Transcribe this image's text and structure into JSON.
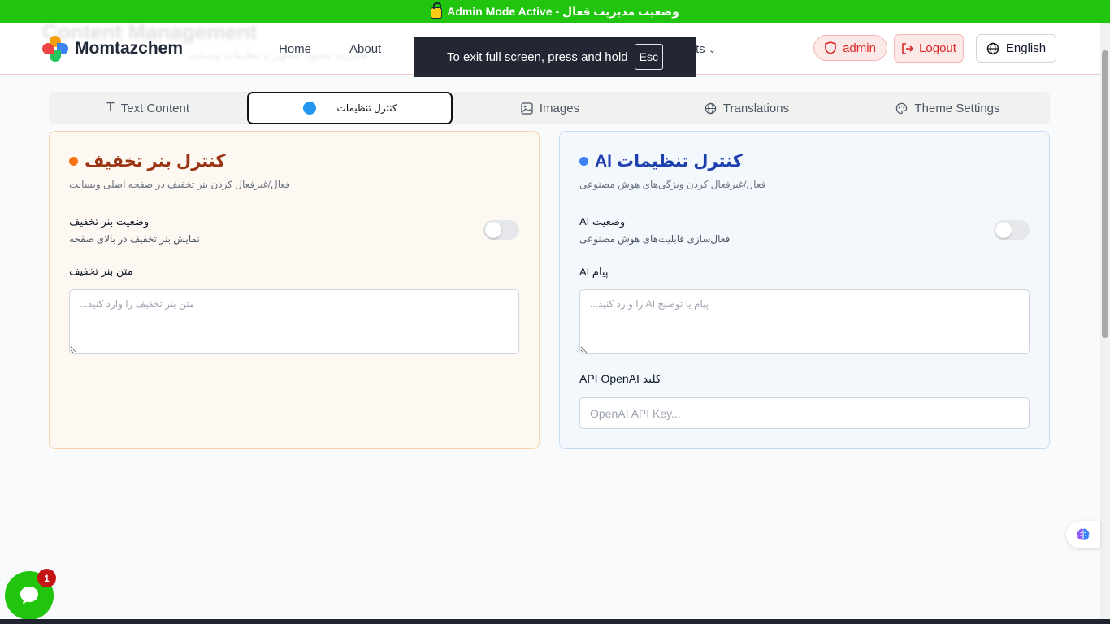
{
  "admin_bar": {
    "text": "وضعیت مدیریت فعال - Admin Mode Active"
  },
  "header": {
    "ghost_title": "Content Management",
    "ghost_subtitle": "مدیریت محتوا، تصاویر و تنظیمات وبسایت",
    "brand": "Momtazchem",
    "nav": [
      {
        "label": "Home"
      },
      {
        "label": "About"
      }
    ],
    "nav_partial": "ts",
    "admin_label": "admin",
    "logout_label": "Logout",
    "language_label": "English"
  },
  "fullscreen_toast": {
    "text": "To exit full screen, press and hold",
    "key": "Esc"
  },
  "tabs": [
    {
      "label": "Text Content",
      "icon": "text-icon"
    },
    {
      "label": "کنترل تنظیمات",
      "icon": "blue-dot-icon",
      "active": true
    },
    {
      "label": "Images",
      "icon": "image-icon"
    },
    {
      "label": "Translations",
      "icon": "globe-icon"
    },
    {
      "label": "Theme Settings",
      "icon": "palette-icon"
    }
  ],
  "discount_card": {
    "title": "کنترل بنر تخفیف",
    "description": "فعال/غیرفعال کردن بنر تخفیف در صفحه اصلی وبسایت",
    "toggle_label": "وضعیت بنر تخفیف",
    "toggle_sub": "نمایش بنر تخفیف در بالای صفحه",
    "toggle_on": false,
    "text_label": "متن بنر تخفیف",
    "text_placeholder": "متن بنر تخفیف را وارد کنید...",
    "accent": "#f97316"
  },
  "ai_card": {
    "title": "کنترل تنظیمات AI",
    "description": "فعال/غیرفعال کردن ویژگی‌های هوش مصنوعی",
    "toggle_label": "وضعیت AI",
    "toggle_sub": "فعال‌سازی قابلیت‌های هوش مصنوعی",
    "toggle_on": false,
    "message_label": "پیام AI",
    "message_placeholder": "پیام یا توضیح AI را وارد کنید...",
    "key_label": "کلید API OpenAI",
    "key_placeholder": "OpenAI API Key...",
    "accent": "#3b82f6"
  },
  "chat_widget": {
    "badge": "1"
  },
  "colors": {
    "admin_green": "#22c50e",
    "danger": "#dc2626"
  }
}
